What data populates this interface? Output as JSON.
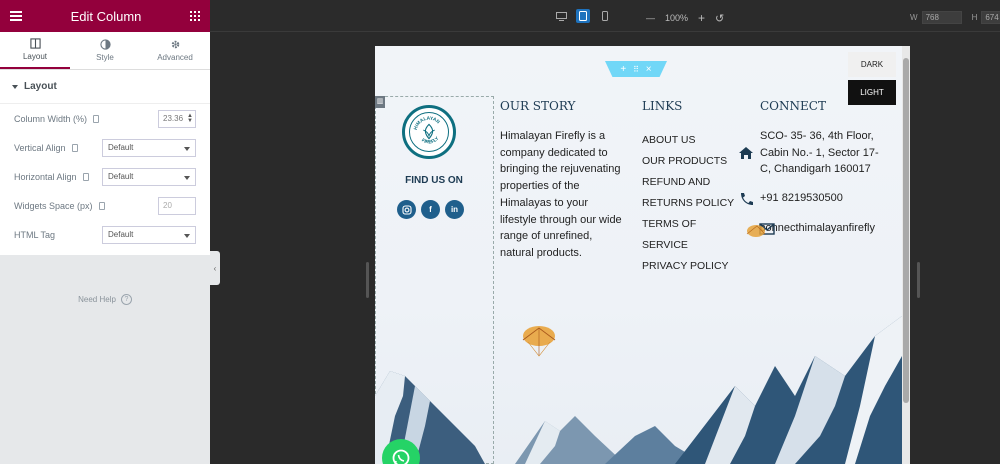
{
  "panel": {
    "title": "Edit Column",
    "tabs": [
      {
        "label": "Layout"
      },
      {
        "label": "Style"
      },
      {
        "label": "Advanced"
      }
    ],
    "section_title": "Layout",
    "controls": {
      "column_width": {
        "label": "Column Width (%)",
        "value": "23.36"
      },
      "vertical_align": {
        "label": "Vertical Align",
        "value": "Default"
      },
      "horizontal_align": {
        "label": "Horizontal Align",
        "value": "Default"
      },
      "widgets_space": {
        "label": "Widgets Space (px)",
        "placeholder": "20"
      },
      "html_tag": {
        "label": "HTML Tag",
        "value": "Default"
      }
    },
    "need_help": "Need Help"
  },
  "topbar": {
    "zoom": "100%",
    "width_label": "W",
    "width_value": "768",
    "height_label": "H",
    "height_value": "674"
  },
  "preview": {
    "find_us": "FIND US ON",
    "logo_text_top": "HIMALAYAN",
    "logo_text_bottom": "FIREFLY",
    "our_story": {
      "title": "OUR STORY",
      "text": "Himalayan Firefly is a company dedicated to bringing the rejuvenating properties of the Himalayas to your lifestyle through our wide range of unrefined, natural products."
    },
    "links": {
      "title": "LINKS",
      "items": [
        "ABOUT US",
        "OUR PRODUCTS",
        "REFUND AND",
        "RETURNS POLICY",
        "TERMS OF",
        "SERVICE",
        "PRIVACY POLICY"
      ]
    },
    "connect": {
      "title": "CONNECT",
      "address": "SCO- 35- 36, 4th Floor, Cabin No.- 1, Sector 17-C, Chandigarh 160017",
      "phone": "+91 8219530500",
      "email": "connecthimalayanfirefly"
    },
    "theme": {
      "dark": "DARK",
      "light": "LIGHT"
    },
    "colors": {
      "brand": "#93003c",
      "accent": "#1f5f8c",
      "whatsapp": "#25d366"
    }
  }
}
